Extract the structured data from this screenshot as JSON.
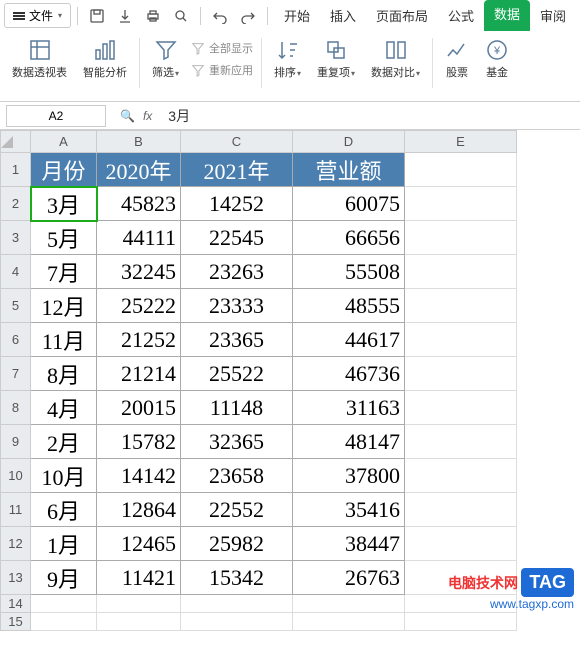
{
  "toolbar": {
    "file_label": "文件",
    "tabs": {
      "start": "开始",
      "insert": "插入",
      "layout": "页面布局",
      "formula": "公式",
      "data": "数据",
      "review": "审阅"
    }
  },
  "ribbon": {
    "pivot": "数据透视表",
    "smart": "智能分析",
    "filter": "筛选",
    "show_all": "全部显示",
    "reapply": "重新应用",
    "sort": "排序",
    "dedup": "重复项",
    "compare": "数据对比",
    "stock": "股票",
    "fund": "基金"
  },
  "formula_bar": {
    "name_box": "A2",
    "fx_label": "fx",
    "value": "3月"
  },
  "columns": [
    "A",
    "B",
    "C",
    "D",
    "E"
  ],
  "headers": {
    "month": "月份",
    "y2020": "2020年",
    "y2021": "2021年",
    "total": "营业额"
  },
  "rows": [
    {
      "month": "3月",
      "y2020": 45823,
      "y2021": 14252,
      "total": 60075
    },
    {
      "month": "5月",
      "y2020": 44111,
      "y2021": 22545,
      "total": 66656
    },
    {
      "month": "7月",
      "y2020": 32245,
      "y2021": 23263,
      "total": 55508
    },
    {
      "month": "12月",
      "y2020": 25222,
      "y2021": 23333,
      "total": 48555
    },
    {
      "month": "11月",
      "y2020": 21252,
      "y2021": 23365,
      "total": 44617
    },
    {
      "month": "8月",
      "y2020": 21214,
      "y2021": 25522,
      "total": 46736
    },
    {
      "month": "4月",
      "y2020": 20015,
      "y2021": 11148,
      "total": 31163
    },
    {
      "month": "2月",
      "y2020": 15782,
      "y2021": 32365,
      "total": 48147
    },
    {
      "month": "10月",
      "y2020": 14142,
      "y2021": 23658,
      "total": 37800
    },
    {
      "month": "6月",
      "y2020": 12864,
      "y2021": 22552,
      "total": 35416
    },
    {
      "month": "1月",
      "y2020": 12465,
      "y2021": 25982,
      "total": 38447
    },
    {
      "month": "9月",
      "y2020": 11421,
      "y2021": 15342,
      "total": 26763
    }
  ],
  "watermark": {
    "site": "电脑技术网",
    "tag": "TAG",
    "url": "www.tagxp.com"
  }
}
